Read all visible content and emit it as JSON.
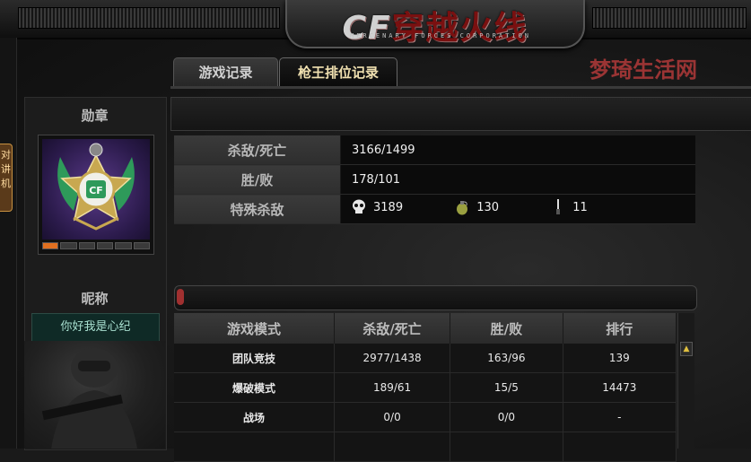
{
  "header": {
    "logo_text": "穿越火线",
    "logo_prefix": "CF",
    "logo_sub": "MERCENARY  FORCES  CORPORATION"
  },
  "side_tab": {
    "label": "对讲机"
  },
  "tabs": [
    {
      "label": "游戏记录",
      "active": false
    },
    {
      "label": "枪王排位记录",
      "active": true
    }
  ],
  "watermark": "梦琦生活网",
  "left_panel": {
    "medal_title": "勋章",
    "nickname_title": "昵称",
    "nickname": "你好我是心纪"
  },
  "stats": {
    "kills_deaths": {
      "label": "杀敌/死亡",
      "value": "3166/1499"
    },
    "win_loss": {
      "label": "胜/败",
      "value": "178/101"
    },
    "special_kills": {
      "label": "特殊杀敌",
      "items": [
        {
          "icon": "skull-icon",
          "value": "3189"
        },
        {
          "icon": "grenade-icon",
          "value": "130"
        },
        {
          "icon": "knife-icon",
          "value": "11"
        }
      ]
    }
  },
  "modes_table": {
    "headers": [
      "游戏模式",
      "杀敌/死亡",
      "胜/败",
      "排行"
    ],
    "rows": [
      [
        "团队竞技",
        "2977/1438",
        "163/96",
        "139"
      ],
      [
        "爆破模式",
        "189/61",
        "15/5",
        "14473"
      ],
      [
        "战场",
        "0/0",
        "0/0",
        "-"
      ],
      [
        "",
        "",
        "",
        ""
      ]
    ]
  },
  "colors": {
    "accent": "#b23a3a",
    "nickname_bg": "#0f2a26"
  }
}
